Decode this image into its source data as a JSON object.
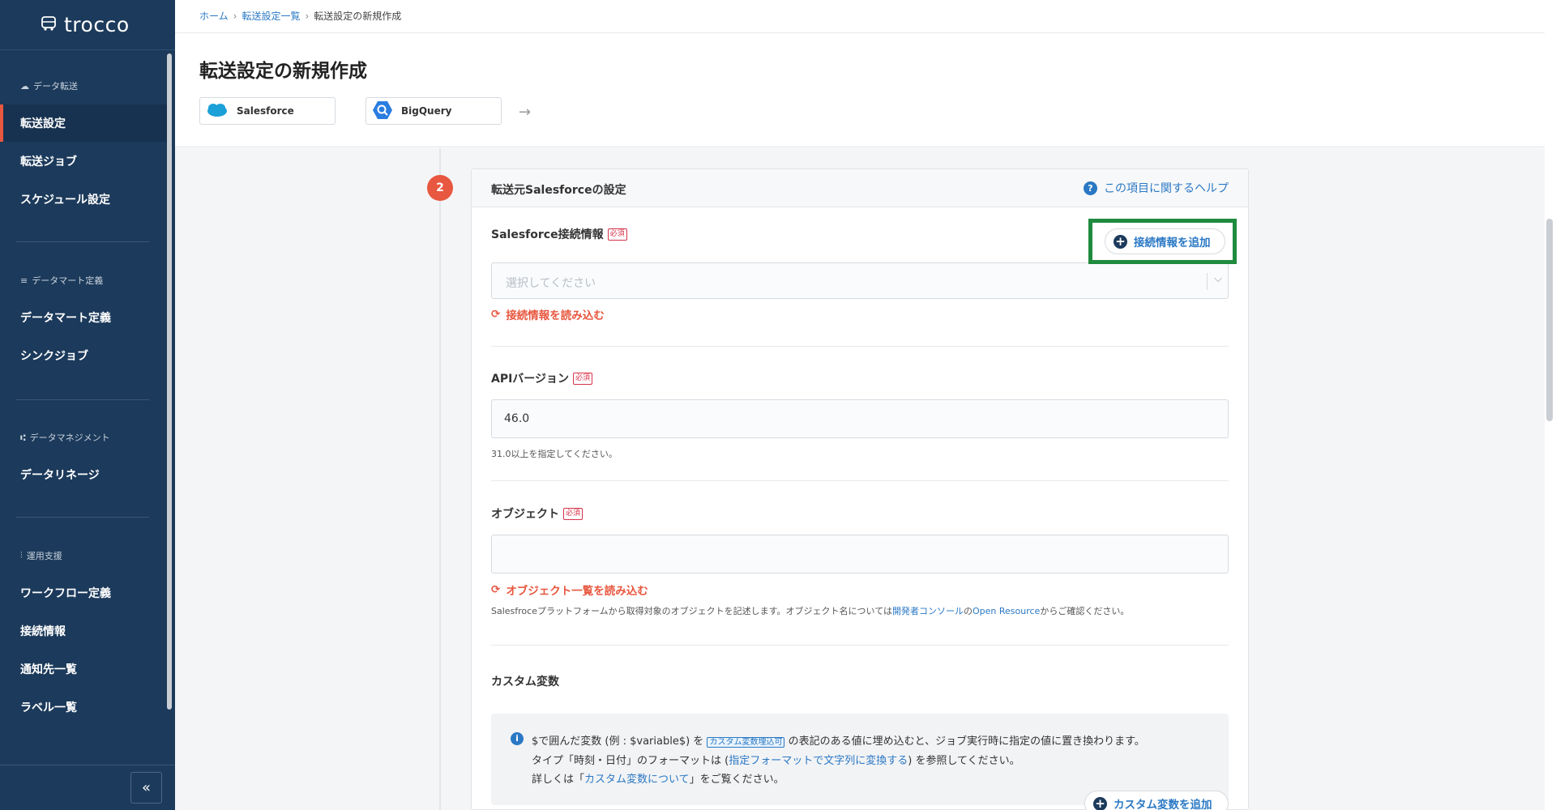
{
  "app": {
    "name": "trocco"
  },
  "sidebar": {
    "sections": [
      {
        "label": "データ転送",
        "icon": "cloud-icon"
      },
      {
        "label": "データマート定義",
        "icon": "list-icon"
      },
      {
        "label": "データマネジメント",
        "icon": "lineage-icon"
      },
      {
        "label": "運用支援",
        "icon": "sliders-icon"
      }
    ],
    "items": [
      {
        "label": "転送設定",
        "active": true
      },
      {
        "label": "転送ジョブ"
      },
      {
        "label": "スケジュール設定"
      },
      {
        "label": "データマート定義"
      },
      {
        "label": "シンクジョブ"
      },
      {
        "label": "データリネージ"
      },
      {
        "label": "ワークフロー定義"
      },
      {
        "label": "接続情報"
      },
      {
        "label": "通知先一覧"
      },
      {
        "label": "ラベル一覧"
      }
    ],
    "collapse_label": "«"
  },
  "breadcrumb": {
    "home": "ホーム",
    "list": "転送設定一覧",
    "current": "転送設定の新規作成"
  },
  "page": {
    "title": "転送設定の新規作成",
    "source": "Salesforce",
    "destination": "BigQuery"
  },
  "card": {
    "step": "2",
    "title": "転送元Salesforceの設定",
    "help": "この項目に関するヘルプ"
  },
  "fields": {
    "required_badge": "必須",
    "connection": {
      "label": "Salesforce接続情報",
      "placeholder": "選択してください",
      "add_button": "接続情報を追加",
      "reload": "接続情報を読み込む"
    },
    "api_version": {
      "label": "APIバージョン",
      "value": "46.0",
      "hint": "31.0以上を指定してください。"
    },
    "object": {
      "label": "オブジェクト",
      "value": "",
      "reload": "オブジェクト一覧を読み込む",
      "hint_prefix": "Salesfroceプラットフォームから取得対象のオブジェクトを記述します。オブジェクト名については",
      "hint_link1": "開発者コンソール",
      "hint_mid": "の",
      "hint_link2": "Open Resource",
      "hint_suffix": "からご確認ください。"
    },
    "custom_vars": {
      "label": "カスタム変数",
      "line1_a": "$で囲んだ変数 (例 : $variable$) を",
      "line1_tag": "カスタム変数埋込可",
      "line1_b": "の表記のある値に埋め込むと、ジョブ実行時に指定の値に置き換わります。",
      "line2_a": "タイプ「時刻・日付」のフォーマットは (",
      "line2_link": "指定フォーマットで文字列に変換する",
      "line2_b": ") を参照してください。",
      "line3_a": "詳しくは「",
      "line3_link": "カスタム変数について",
      "line3_b": "」をご覧ください。",
      "add_button": "カスタム変数を追加"
    }
  },
  "colors": {
    "sidebar_bg": "#1c3a5b",
    "accent_orange": "#e8573f",
    "link_blue": "#2a78c4",
    "highlight_green": "#1f8b3f"
  }
}
